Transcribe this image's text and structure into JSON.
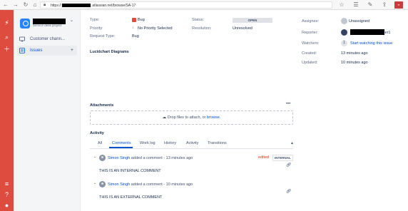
{
  "browser": {
    "url_prefix": "https://",
    "url_suffix": ".atlassian.net/browse/SA-17"
  },
  "project": {
    "type": "Service desk project"
  },
  "sidebar": {
    "items": [
      {
        "label": "Customer chann..."
      },
      {
        "label": "Issues"
      }
    ]
  },
  "details": {
    "type_label": "Type:",
    "type_value": "Bug",
    "priority_label": "Priority:",
    "priority_value": "No Priority Selected",
    "request_type_label": "Request Type:",
    "request_type_value": "Bug",
    "status_label": "Status:",
    "status_value": "OPEN",
    "resolution_label": "Resolution:",
    "resolution_value": "Unresolved"
  },
  "people": {
    "assignee_label": "Assignee:",
    "assignee_value": "Unassigned",
    "reporter_label": "Reporter:",
    "reporter_suffix": "ter1",
    "watchers_label": "Watchers:",
    "watchers_count": "1",
    "watch_link": "Start watching this issue",
    "created_label": "Created:",
    "created_value": "13 minutes ago",
    "updated_label": "Updated:",
    "updated_value": "10 minutes ago"
  },
  "lucidchart": {
    "title": "Lucidchart Diagrams"
  },
  "attachments": {
    "title": "Attachments",
    "more": "•••",
    "drop_text": "Drop files to attach, or",
    "browse_link": "browse."
  },
  "activity": {
    "title": "Activity",
    "tabs": [
      "All",
      "Comments",
      "Work log",
      "History",
      "Activity",
      "Transitions"
    ],
    "active_tab": "Comments",
    "comments": [
      {
        "author": "Simon Singh",
        "action": "added a comment - 13 minutes ago",
        "edited": "edited",
        "badge": "INTERNAL",
        "body": "THIS IS AN INTERNAL COMMENT"
      },
      {
        "author": "Simon Singh",
        "action": "added a comment - 10 minutes ago",
        "body": "THIS IS AN EXTERNAL COMMENT"
      }
    ]
  },
  "colors": {
    "rail": "#de4b3f",
    "link": "#0052cc",
    "edited": "#de350b"
  }
}
